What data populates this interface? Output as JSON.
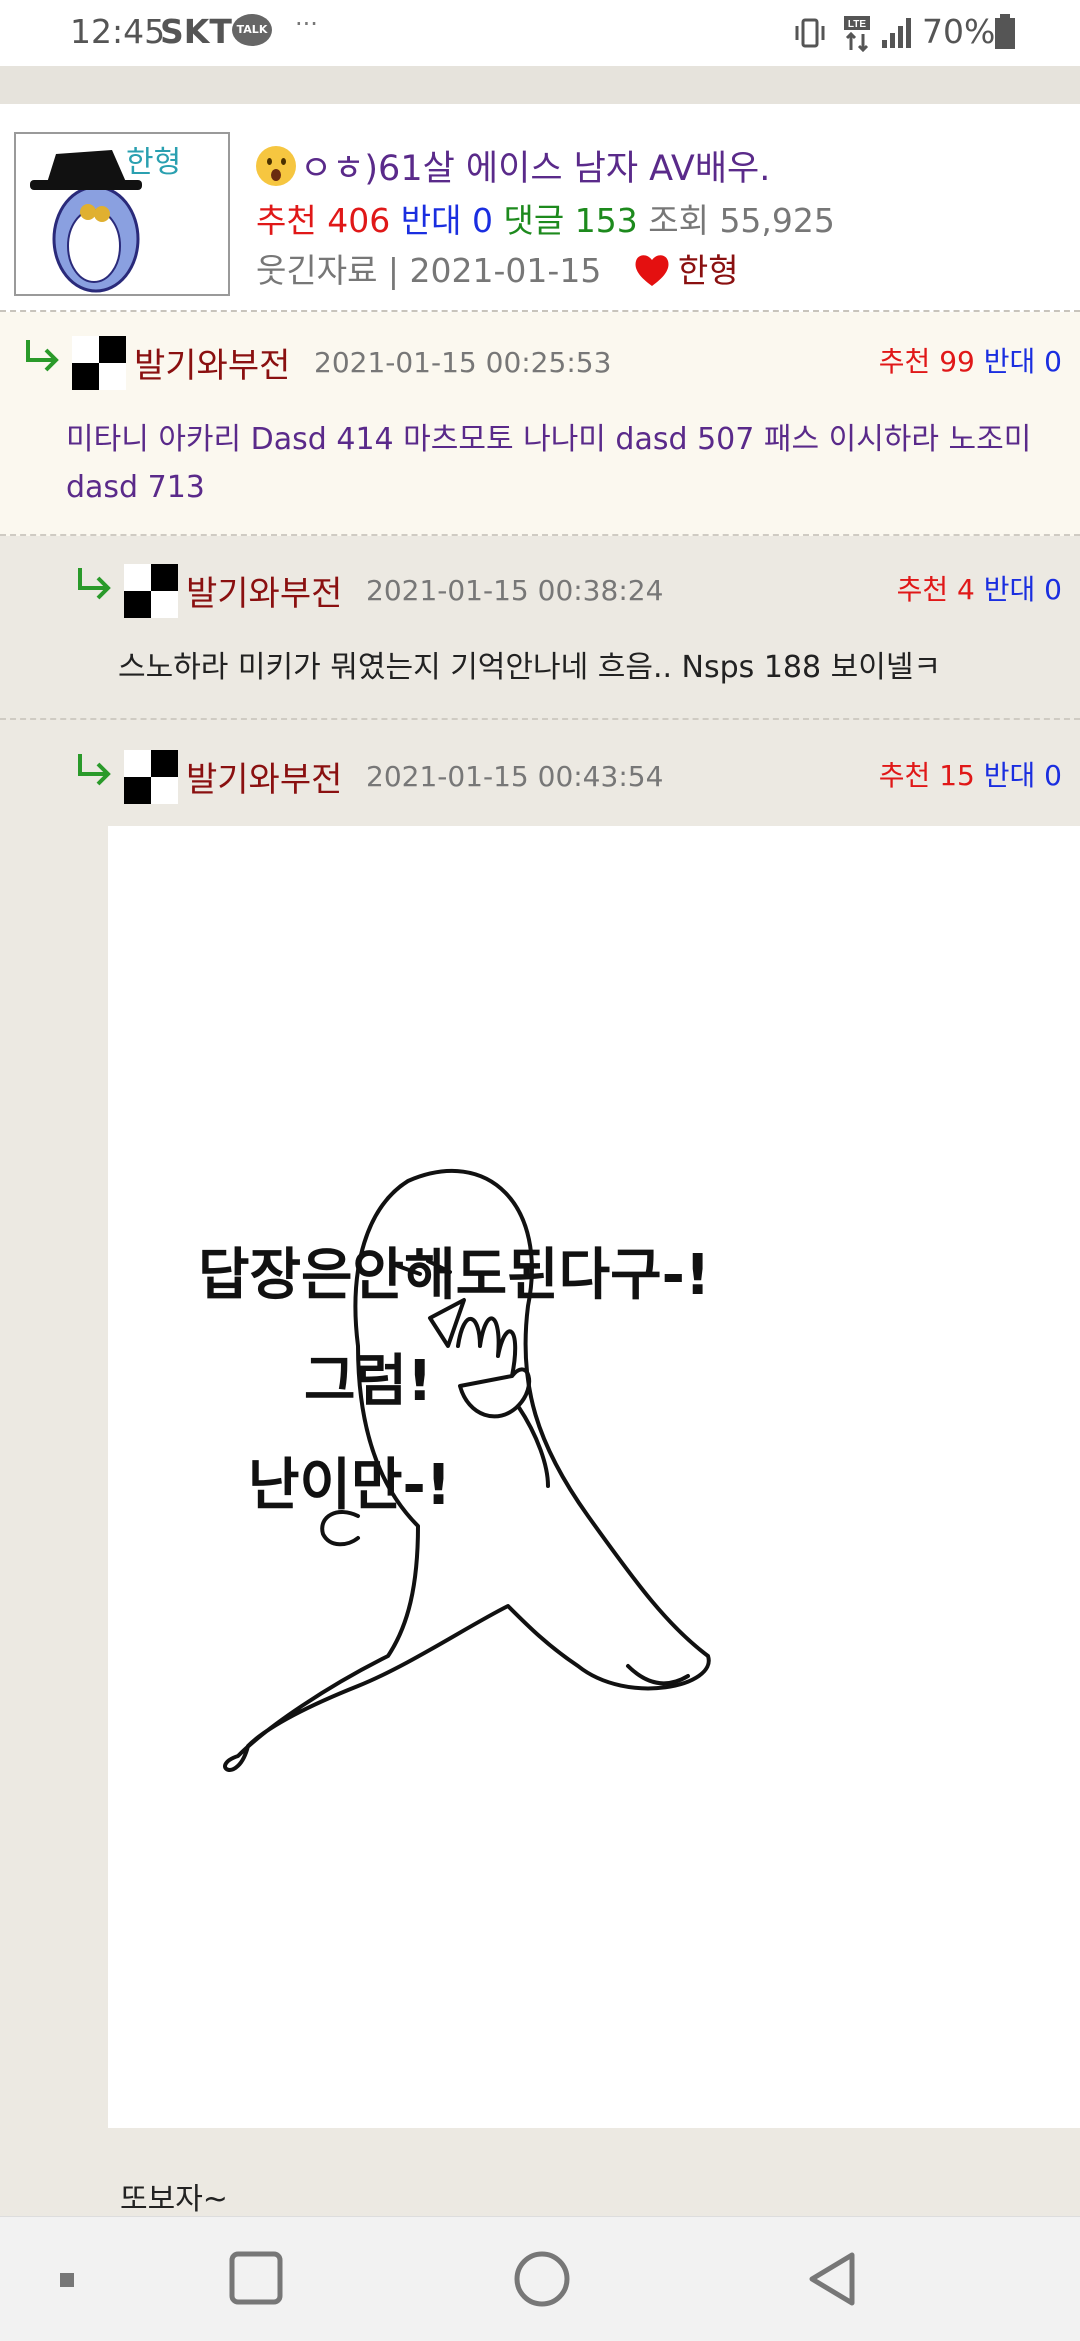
{
  "status_bar": {
    "time": "12:45",
    "carrier": "SKT",
    "talk_badge": "TALK",
    "more_dots": "···",
    "battery": "70%"
  },
  "post": {
    "title": "ㅇㅎ)61살 에이스 남자 AV배우.",
    "recommend_label": "추천",
    "recommend_count": "406",
    "oppose_label": "반대",
    "oppose_count": "0",
    "comment_label": "댓글",
    "comment_count": "153",
    "views_label": "조회",
    "views_count": "55,925",
    "category_date": "웃긴자료 | 2021-01-15",
    "author": "한형",
    "avatar_text": "한형"
  },
  "comments": [
    {
      "author": "발기와부전",
      "date": "2021-01-15 00:25:53",
      "recommend_label": "추천",
      "recommend_count": "99",
      "oppose_label": "반대",
      "oppose_count": "0",
      "body": "미타니 아카리 Dasd 414 마츠모토 나나미 dasd 507 패스 이시하라 노조미 dasd 713"
    },
    {
      "author": "발기와부전",
      "date": "2021-01-15 00:38:24",
      "recommend_label": "추천",
      "recommend_count": "4",
      "oppose_label": "반대",
      "oppose_count": "0",
      "body": "스노하라 미키가 뭐였는지 기억안나네 흐음.. Nsps 188 보이넬ㅋ"
    },
    {
      "author": "발기와부전",
      "date": "2021-01-15 00:43:54",
      "recommend_label": "추천",
      "recommend_count": "15",
      "oppose_label": "반대",
      "oppose_count": "0",
      "image_text": [
        "답장은안해도된다구-!",
        "그럼!",
        "난이만-!"
      ],
      "body": "또보자~"
    }
  ],
  "colors": {
    "recommend": "#e01818",
    "oppose": "#1a2ee0",
    "comment_count": "#1d8a1d",
    "title": "#5a2a8a",
    "author": "#8a1010"
  },
  "nav": [
    "recent-apps-icon",
    "home-icon",
    "back-icon"
  ]
}
